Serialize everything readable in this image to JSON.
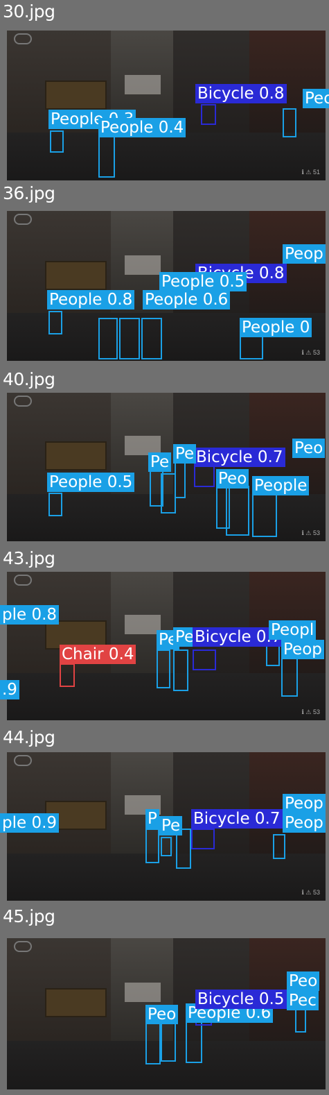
{
  "panels": [
    {
      "file": "30.jpg",
      "badge": "ℹ ⚠ 51",
      "labels": [
        {
          "text": "Bicycle 0.8",
          "cls": "blue"
        },
        {
          "text": "Peop",
          "cls": ""
        },
        {
          "text": "People 0.3",
          "cls": ""
        },
        {
          "text": "People 0.4",
          "cls": ""
        }
      ]
    },
    {
      "file": "36.jpg",
      "badge": "ℹ ⚠ 53",
      "labels": [
        {
          "text": "Peop",
          "cls": ""
        },
        {
          "text": "Bicycle 0.8",
          "cls": "blue"
        },
        {
          "text": "People 0.5",
          "cls": ""
        },
        {
          "text": "People 0.8",
          "cls": ""
        },
        {
          "text": "People 0.6",
          "cls": ""
        },
        {
          "text": "People 0",
          "cls": ""
        }
      ]
    },
    {
      "file": "40.jpg",
      "badge": "ℹ ⚠ 53",
      "labels": [
        {
          "text": "Peo",
          "cls": ""
        },
        {
          "text": "Bicycle 0.7",
          "cls": "blue"
        },
        {
          "text": "People 0.5",
          "cls": ""
        },
        {
          "text": "Pe",
          "cls": ""
        },
        {
          "text": "Pe",
          "cls": ""
        },
        {
          "text": "Peo",
          "cls": ""
        },
        {
          "text": "People",
          "cls": ""
        }
      ]
    },
    {
      "file": "43.jpg",
      "badge": "ℹ ⚠ 53",
      "labels": [
        {
          "text": "ple 0.8",
          "cls": ""
        },
        {
          "text": "Chair 0.4",
          "cls": "red"
        },
        {
          "text": ".9",
          "cls": ""
        },
        {
          "text": "Pe",
          "cls": ""
        },
        {
          "text": "Pe",
          "cls": ""
        },
        {
          "text": "Bicycle 0.7",
          "cls": "blue"
        },
        {
          "text": "Peopl",
          "cls": ""
        },
        {
          "text": "Peop",
          "cls": ""
        }
      ]
    },
    {
      "file": "44.jpg",
      "badge": "ℹ ⚠ 53",
      "labels": [
        {
          "text": "ple 0.9",
          "cls": ""
        },
        {
          "text": "P",
          "cls": ""
        },
        {
          "text": "Pe",
          "cls": ""
        },
        {
          "text": "Bicycle 0.7",
          "cls": "blue"
        },
        {
          "text": "Peop",
          "cls": ""
        },
        {
          "text": "Peop",
          "cls": ""
        }
      ]
    },
    {
      "file": "45.jpg",
      "badge": "ℹ ⚠ 53",
      "labels": [
        {
          "text": "Peo",
          "cls": ""
        },
        {
          "text": "People 0.6",
          "cls": ""
        },
        {
          "text": "Bicycle 0.5",
          "cls": "blue"
        },
        {
          "text": "Peo",
          "cls": ""
        },
        {
          "text": "Pec",
          "cls": ""
        }
      ]
    }
  ]
}
